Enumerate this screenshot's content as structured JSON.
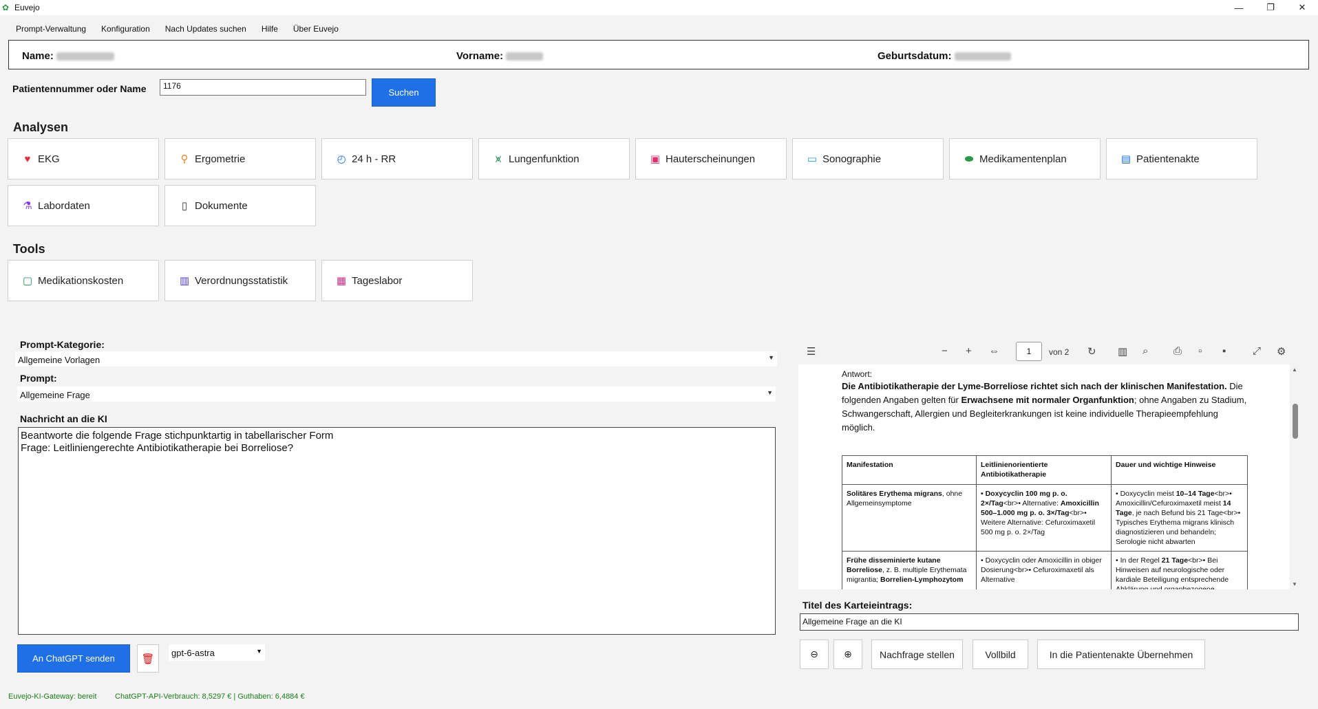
{
  "window": {
    "title": "Euvejo"
  },
  "menu": [
    "Prompt-Verwaltung",
    "Konfiguration",
    "Nach Updates suchen",
    "Hilfe",
    "Über Euvejo"
  ],
  "patient": {
    "name_label": "Name:",
    "vorname_label": "Vorname:",
    "geburtsdatum_label": "Geburtsdatum:"
  },
  "search": {
    "label": "Patientennummer oder Name",
    "value": "1176",
    "button": "Suchen"
  },
  "analysen": {
    "title": "Analysen",
    "tiles": [
      {
        "label": "EKG",
        "icon": "heart-pulse-icon",
        "color": "#e0303a"
      },
      {
        "label": "Ergometrie",
        "icon": "bicycle-icon",
        "color": "#f08020"
      },
      {
        "label": "24 h - RR",
        "icon": "stopwatch-icon",
        "color": "#1f6fe6"
      },
      {
        "label": "Lungenfunktion",
        "icon": "lungs-icon",
        "color": "#1c8a5a"
      },
      {
        "label": "Hauterscheinungen",
        "icon": "skin-icon",
        "color": "#e0306a"
      },
      {
        "label": "Sonographie",
        "icon": "ultrasound-icon",
        "color": "#1a9ad0"
      },
      {
        "label": "Medikamentenplan",
        "icon": "pill-icon",
        "color": "#2a9a4a"
      },
      {
        "label": "Patientenakte",
        "icon": "folder-icon",
        "color": "#1f6fe6"
      },
      {
        "label": "Labordaten",
        "icon": "flask-icon",
        "color": "#8a3ad8"
      },
      {
        "label": "Dokumente",
        "icon": "document-search-icon",
        "color": "#333333"
      }
    ]
  },
  "tools": {
    "title": "Tools",
    "tiles": [
      {
        "label": "Medikationskosten",
        "icon": "cost-chat-icon",
        "color": "#1c8a5a"
      },
      {
        "label": "Verordnungsstatistik",
        "icon": "bar-chart-icon",
        "color": "#4a3ad8"
      },
      {
        "label": "Tageslabor",
        "icon": "calendar-icon",
        "color": "#c0308a"
      }
    ]
  },
  "prompt": {
    "kategorie_label": "Prompt-Kategorie:",
    "kategorie_value": "Allgemeine Vorlagen",
    "prompt_label": "Prompt:",
    "prompt_value": "Allgemeine Frage",
    "nachricht_label": "Nachricht an die KI",
    "nachricht_value": "Beantworte die folgende Frage stichpunktartig in tabellarischer Form\nFrage: Leitliniengerechte Antibiotikatherapie bei Borreliose?",
    "send_button": "An ChatGPT senden",
    "model": "gpt-6-astra"
  },
  "pdf": {
    "page": "1",
    "of_pages": "von 2",
    "antwort_label": "Antwort:",
    "intro_bold": "Die Antibiotikatherapie der Lyme-Borreliose richtet sich nach der klinischen Manifestation.",
    "intro_text1": " Die folgenden Angaben gelten für ",
    "intro_bold2": "Erwachsene mit normaler Organfunktion",
    "intro_text2": "; ohne Angaben zu Stadium, Schwangerschaft, Allergien und Begleiterkrankungen ist keine individuelle Therapieempfehlung möglich.",
    "table_headers": [
      "Manifestation",
      "Leitlinienorientierte Antibiotikatherapie",
      "Dauer und wichtige Hinweise"
    ],
    "row1": {
      "c1_bold": "Solitäres Erythema migrans",
      "c1_text": ", ohne Allgemeinsymptome",
      "c2_a": "• Doxycyclin 100 mg p. o. 2×/Tag",
      "c2_b": "<br>• Alternative: ",
      "c2_c": "Amoxicillin 500–1.000 mg p. o. 3×/Tag",
      "c2_d": "<br>• Weitere Alternative: Cefuroximaxetil 500 mg p. o. 2×/Tag",
      "c3_a": "• Doxycyclin meist ",
      "c3_b": "10–14 Tage",
      "c3_c": "<br>• Amoxicillin/Cefuroximaxetil meist ",
      "c3_d": "14 Tage",
      "c3_e": ", je nach Befund bis 21 Tage<br>• Typisches Erythema migrans klinisch diagnostizieren und behandeln; Serologie nicht abwarten"
    },
    "row2": {
      "c1_bold": "Frühe disseminierte kutane Borreliose",
      "c1_text": ", z. B. multiple Erythemata migrantia; ",
      "c1_bold2": "Borrelien-Lymphozytom",
      "c2": "• Doxycyclin oder Amoxicillin in obiger Dosierung<br>• Cefuroximaxetil als Alternative",
      "c3_a": "• In der Regel ",
      "c3_b": "21 Tage",
      "c3_c": "<br>• Bei Hinweisen auf neurologische oder kardiale Beteiligung entsprechende Abklärung und organbezogene"
    }
  },
  "kartei": {
    "label": "Titel des Karteieintrags:",
    "value": "Allgemeine Frage an die KI",
    "nachfrage": "Nachfrage stellen",
    "vollbild": "Vollbild",
    "uebernehmen": "In die Patientenakte Übernehmen"
  },
  "status": {
    "gateway": "Euvejo-KI-Gateway: bereit",
    "usage": "ChatGPT-API-Verbrauch: 8,5297 € | Guthaben: 6,4884 €"
  }
}
